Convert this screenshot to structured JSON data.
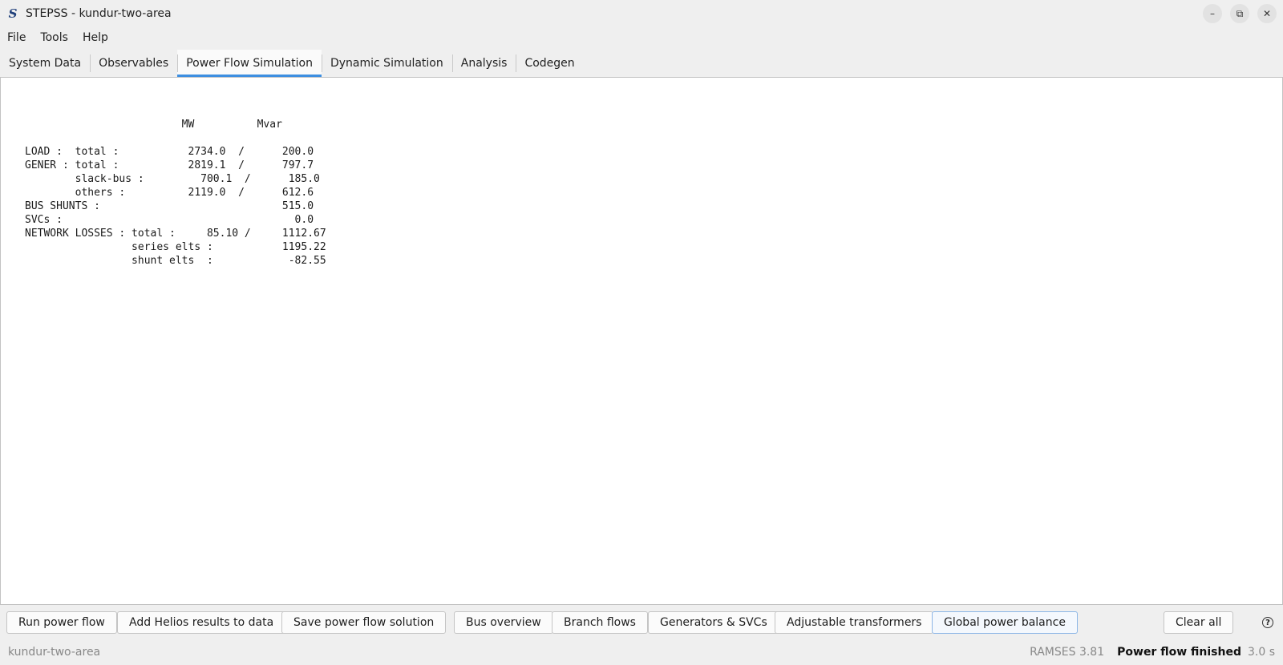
{
  "window": {
    "app_icon": "S",
    "title": "STEPSS - kundur-two-area",
    "controls": {
      "minimize": "–",
      "maximize": "⧉",
      "close": "✕"
    }
  },
  "menu": [
    "File",
    "Tools",
    "Help"
  ],
  "tabs": [
    {
      "label": "System Data",
      "active": false
    },
    {
      "label": "Observables",
      "active": false
    },
    {
      "label": "Power Flow Simulation",
      "active": true
    },
    {
      "label": "Dynamic Simulation",
      "active": false
    },
    {
      "label": "Analysis",
      "active": false
    },
    {
      "label": "Codegen",
      "active": false
    }
  ],
  "report": [
    "",
    "                         MW          Mvar",
    "",
    "LOAD :  total :           2734.0  /      200.0",
    "GENER : total :           2819.1  /      797.7",
    "        slack-bus :         700.1  /      185.0",
    "        others :          2119.0  /      612.6",
    "BUS SHUNTS :                             515.0",
    "SVCs :                                     0.0",
    "NETWORK LOSSES : total :     85.10 /     1112.67",
    "                 series elts :           1195.22",
    "                 shunt elts  :            -82.55"
  ],
  "buttons": {
    "run_power_flow": "Run power flow",
    "add_helios": "Add Helios results to data",
    "save_solution": "Save power flow solution",
    "bus_overview": "Bus overview",
    "branch_flows": "Branch flows",
    "generators_svcs": "Generators & SVCs",
    "adjustable_transformers": "Adjustable transformers",
    "global_power_balance": "Global power balance",
    "clear_all": "Clear all",
    "help": "?"
  },
  "status": {
    "project": "kundur-two-area",
    "version": "RAMSES 3.81",
    "message": "Power flow finished",
    "elapsed": "3.0 s"
  },
  "colors": {
    "tab_accent": "#3d8ee0",
    "highlight_border": "#8cb6e6"
  }
}
